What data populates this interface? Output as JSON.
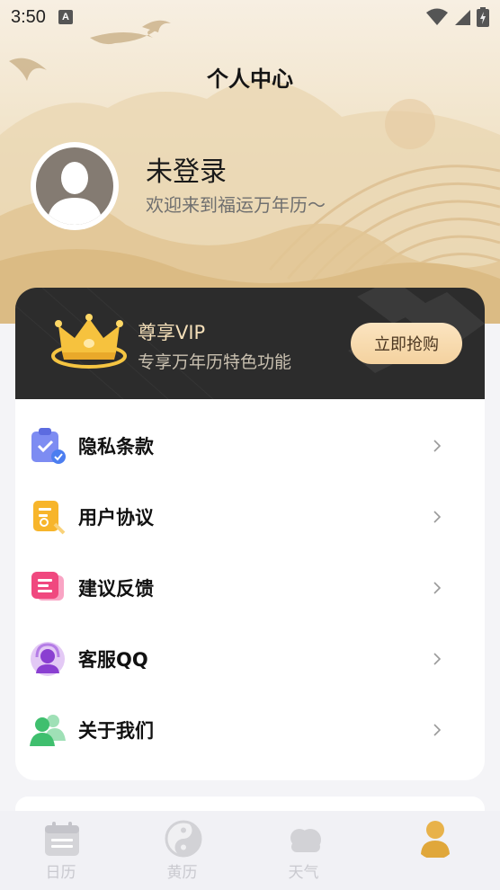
{
  "status_bar": {
    "time": "3:50",
    "notification_badge": "A"
  },
  "header": {
    "title": "个人中心"
  },
  "profile": {
    "username": "未登录",
    "welcome": "欢迎来到福运万年历～"
  },
  "vip": {
    "title": "尊享VIP",
    "subtitle": "专享万年历特色功能",
    "button_label": "立即抢购"
  },
  "menu": {
    "items": [
      {
        "label": "隐私条款",
        "icon": "privacy-clipboard-icon"
      },
      {
        "label": "用户协议",
        "icon": "agreement-document-icon"
      },
      {
        "label": "建议反馈",
        "icon": "feedback-message-icon"
      },
      {
        "label": "客服QQ",
        "icon": "customer-service-icon"
      },
      {
        "label": "关于我们",
        "icon": "about-people-icon"
      }
    ]
  },
  "bottom_nav": {
    "items": [
      {
        "label": "日历",
        "icon": "calendar-icon",
        "active": false
      },
      {
        "label": "黄历",
        "icon": "yin-yang-icon",
        "active": false
      },
      {
        "label": "天气",
        "icon": "cloud-icon",
        "active": false
      },
      {
        "label": "",
        "icon": "person-icon",
        "active": true
      }
    ]
  },
  "colors": {
    "vip_card": "#2c2c2c",
    "vip_accent": "#f4d29f",
    "hero_bg": "#f1e3c8",
    "active_tab": "#e0a73a",
    "inactive_tab": "#c9c9cf"
  }
}
